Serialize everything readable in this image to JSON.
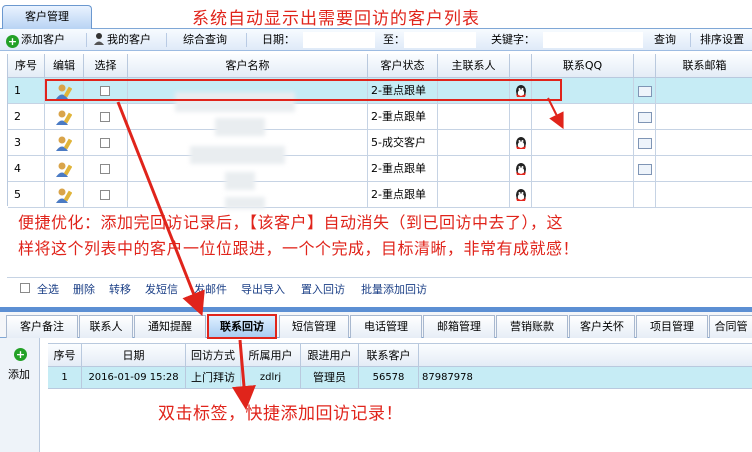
{
  "header": {
    "tab_label": "客户管理",
    "annotation_title": "系统自动显示出需要回访的客户列表"
  },
  "toolbar": {
    "add_customer": "添加客户",
    "my_customers": "我的客户",
    "combined_query": "综合查询",
    "date_label": "日期：",
    "to_label": "至：",
    "keyword_label": "关键字：",
    "query": "查询",
    "sort_settings": "排序设置",
    "date_from": "",
    "date_to": "",
    "keyword": ""
  },
  "grid": {
    "columns": [
      "序号",
      "编辑",
      "选择",
      "客户名称",
      "客户状态",
      "主联系人",
      "联系QQ",
      "联系邮箱"
    ],
    "rows": [
      {
        "no": "1",
        "name": "",
        "status": "2-重点跟单",
        "contact": ""
      },
      {
        "no": "2",
        "name": "",
        "status": "2-重点跟单",
        "contact": ""
      },
      {
        "no": "3",
        "name": "",
        "status": "5-成交客户",
        "contact": ""
      },
      {
        "no": "4",
        "name": "",
        "status": "2-重点跟单",
        "contact": ""
      },
      {
        "no": "5",
        "name": "",
        "status": "2-重点跟单",
        "contact": ""
      }
    ]
  },
  "annotation_middle": {
    "line1": "便捷优化：添加完回访记录后，【该客户】自动消失（到已回访中去了），这",
    "line2": "样将这个列表中的客户一位位跟进，一个个完成，目标清晰，非常有成就感！"
  },
  "actions": {
    "select_all": "全选",
    "delete": "删除",
    "transfer": "转移",
    "send_sms": "发短信",
    "send_mail": "发邮件",
    "import_export": "导出导入",
    "set_followup": "置入回访",
    "batch_add_followup": "批量添加回访"
  },
  "bottom_tabs": [
    "客户备注",
    "联系人",
    "通知提醒",
    "联系回访",
    "短信管理",
    "电话管理",
    "邮箱管理",
    "营销账款",
    "客户关怀",
    "项目管理",
    "合同管"
  ],
  "sub_grid": {
    "add_label": "添加",
    "columns": [
      "序号",
      "日期",
      "回访方式",
      "所属用户",
      "跟进用户",
      "联系客户"
    ],
    "row": {
      "no": "1",
      "date": "2016-01-09 15:28",
      "method": "上门拜访",
      "owner": "zdlrj",
      "follower": "管理员",
      "customer": "56578",
      "phone": "87987978"
    }
  },
  "annotation_bottom": "双击标签，快捷添加回访记录！",
  "colors": {
    "annotation_red": "#e0241b",
    "selected_row": "#c6ecf5",
    "accent_blue": "#5c8fd3"
  }
}
